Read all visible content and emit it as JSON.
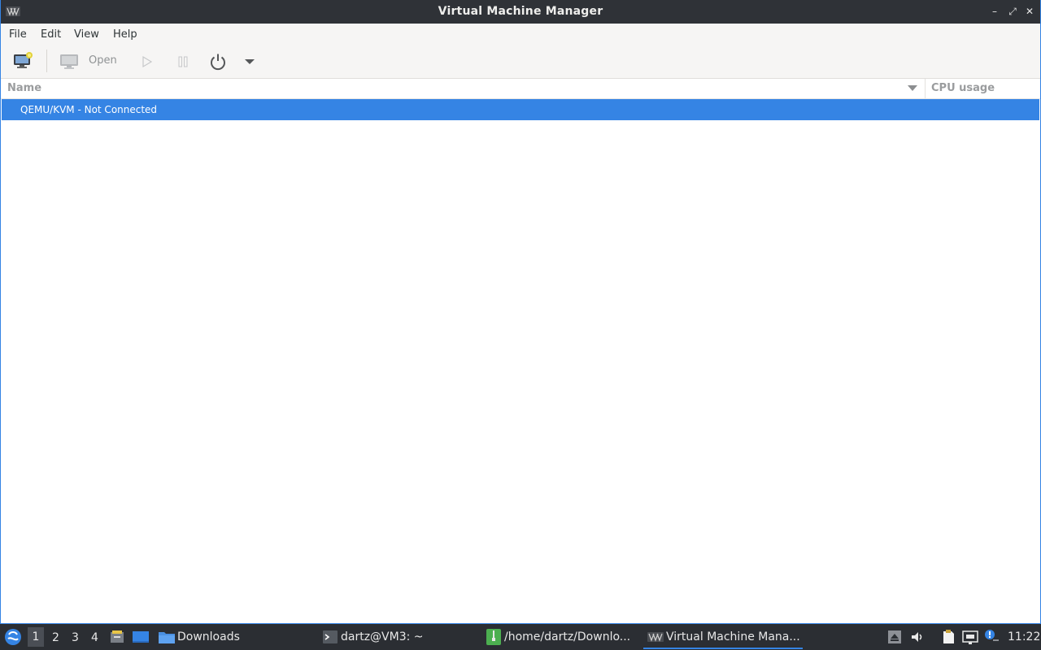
{
  "window": {
    "title": "Virtual Machine Manager",
    "minimize_glyph": "–",
    "maximize_glyph": "⤢",
    "close_glyph": "✕"
  },
  "menubar": {
    "items": [
      {
        "label": "File"
      },
      {
        "label": "Edit"
      },
      {
        "label": "View"
      },
      {
        "label": "Help"
      }
    ]
  },
  "toolbar": {
    "open_label": "Open",
    "icons": [
      "new-vm-icon",
      "monitor-icon",
      "play-icon",
      "pause-icon",
      "power-icon",
      "dropdown-arrow-icon"
    ]
  },
  "list": {
    "columns": [
      {
        "label": "Name"
      },
      {
        "label": "CPU usage"
      }
    ],
    "rows": [
      {
        "label": "QEMU/KVM - Not Connected",
        "selected": true
      }
    ]
  },
  "taskbar": {
    "workspaces": [
      "1",
      "2",
      "3",
      "4"
    ],
    "active_workspace": "1",
    "tasks": [
      {
        "label": "Downloads",
        "icon": "folder-icon"
      },
      {
        "label": "dartz@VM3: ~",
        "icon": "terminal-icon"
      },
      {
        "label": "/home/dartz/Downlo...",
        "icon": "archive-icon"
      },
      {
        "label": "Virtual Machine Mana...",
        "icon": "virt-manager-icon",
        "active": true
      }
    ],
    "clock": "11:22"
  },
  "colors": {
    "accent": "#3584e4",
    "titlebar": "#2f3237",
    "panel": "#2b2e33",
    "toolbar_bg": "#f6f5f4"
  }
}
